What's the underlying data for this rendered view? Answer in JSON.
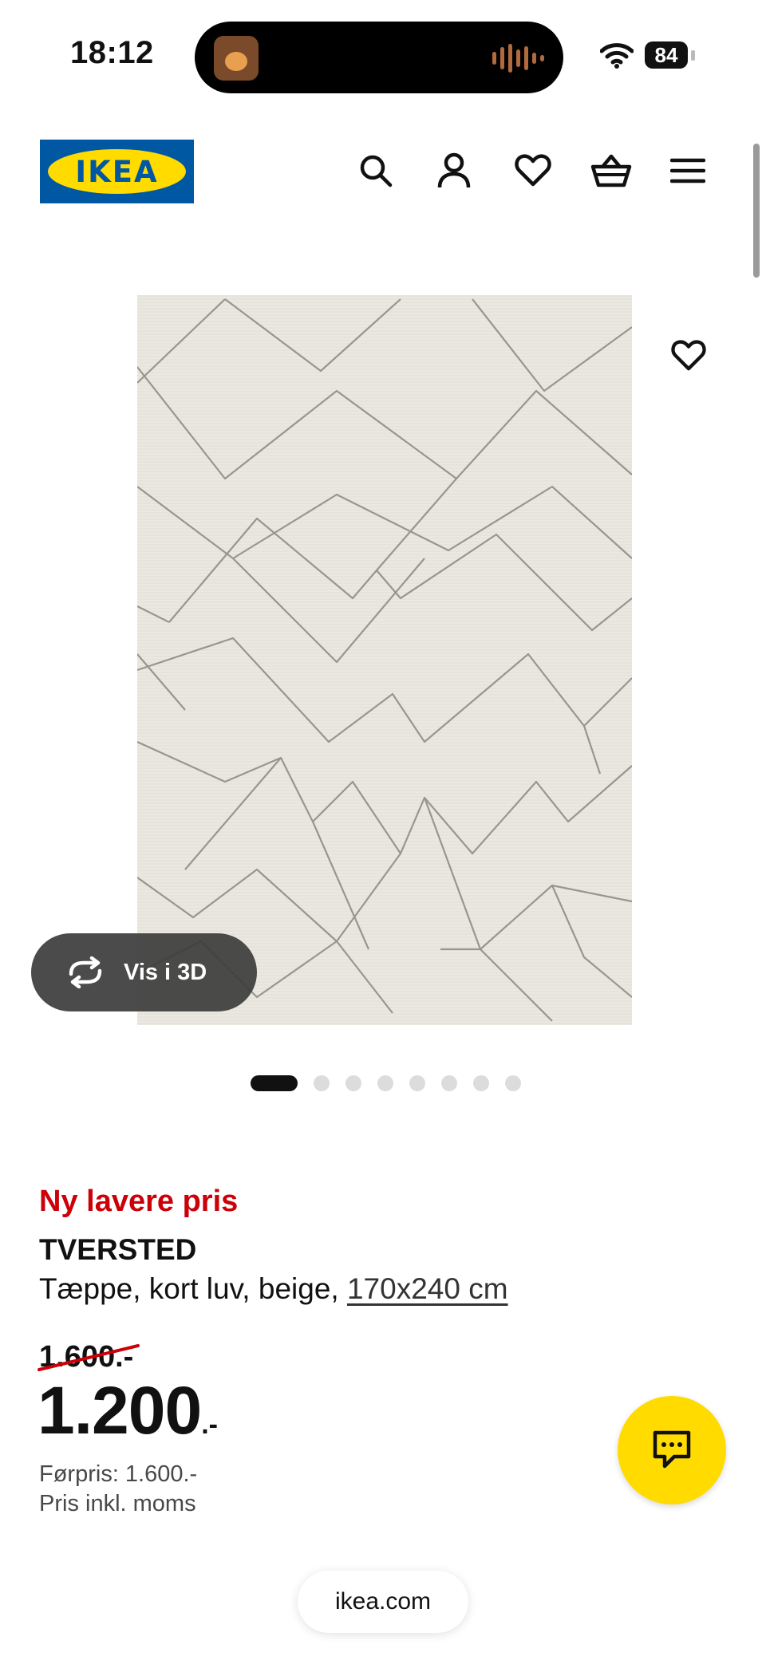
{
  "status_bar": {
    "time": "18:12",
    "battery": "84",
    "icons": [
      "now-playing-artwork",
      "audio-waveform-icon",
      "wifi-icon",
      "battery-icon"
    ]
  },
  "header": {
    "logo_text": "IKEA",
    "icons": [
      "search-icon",
      "account-icon",
      "heart-icon",
      "basket-icon",
      "menu-icon"
    ],
    "colors": {
      "logo_blue": "#0058a3",
      "logo_yellow": "#ffdb00"
    }
  },
  "gallery": {
    "view_3d_label": "Vis i 3D",
    "dot_count": 8,
    "active_dot": 1
  },
  "product": {
    "promo_label": "Ny lavere pris",
    "name": "TVERSTED",
    "description": "Tæppe, kort luv, beige,",
    "size_link": "170x240 cm",
    "old_price": "1.600.-",
    "price_main": "1.200",
    "price_suffix": ".-",
    "previous_price": "Førpris: 1.600.-",
    "vat_note": "Pris inkl. moms",
    "colors": {
      "promo_red": "#cc0008"
    }
  },
  "chat": {
    "icon": "chat-icon",
    "color": "#ffdb00"
  },
  "browser": {
    "url": "ikea.com"
  }
}
